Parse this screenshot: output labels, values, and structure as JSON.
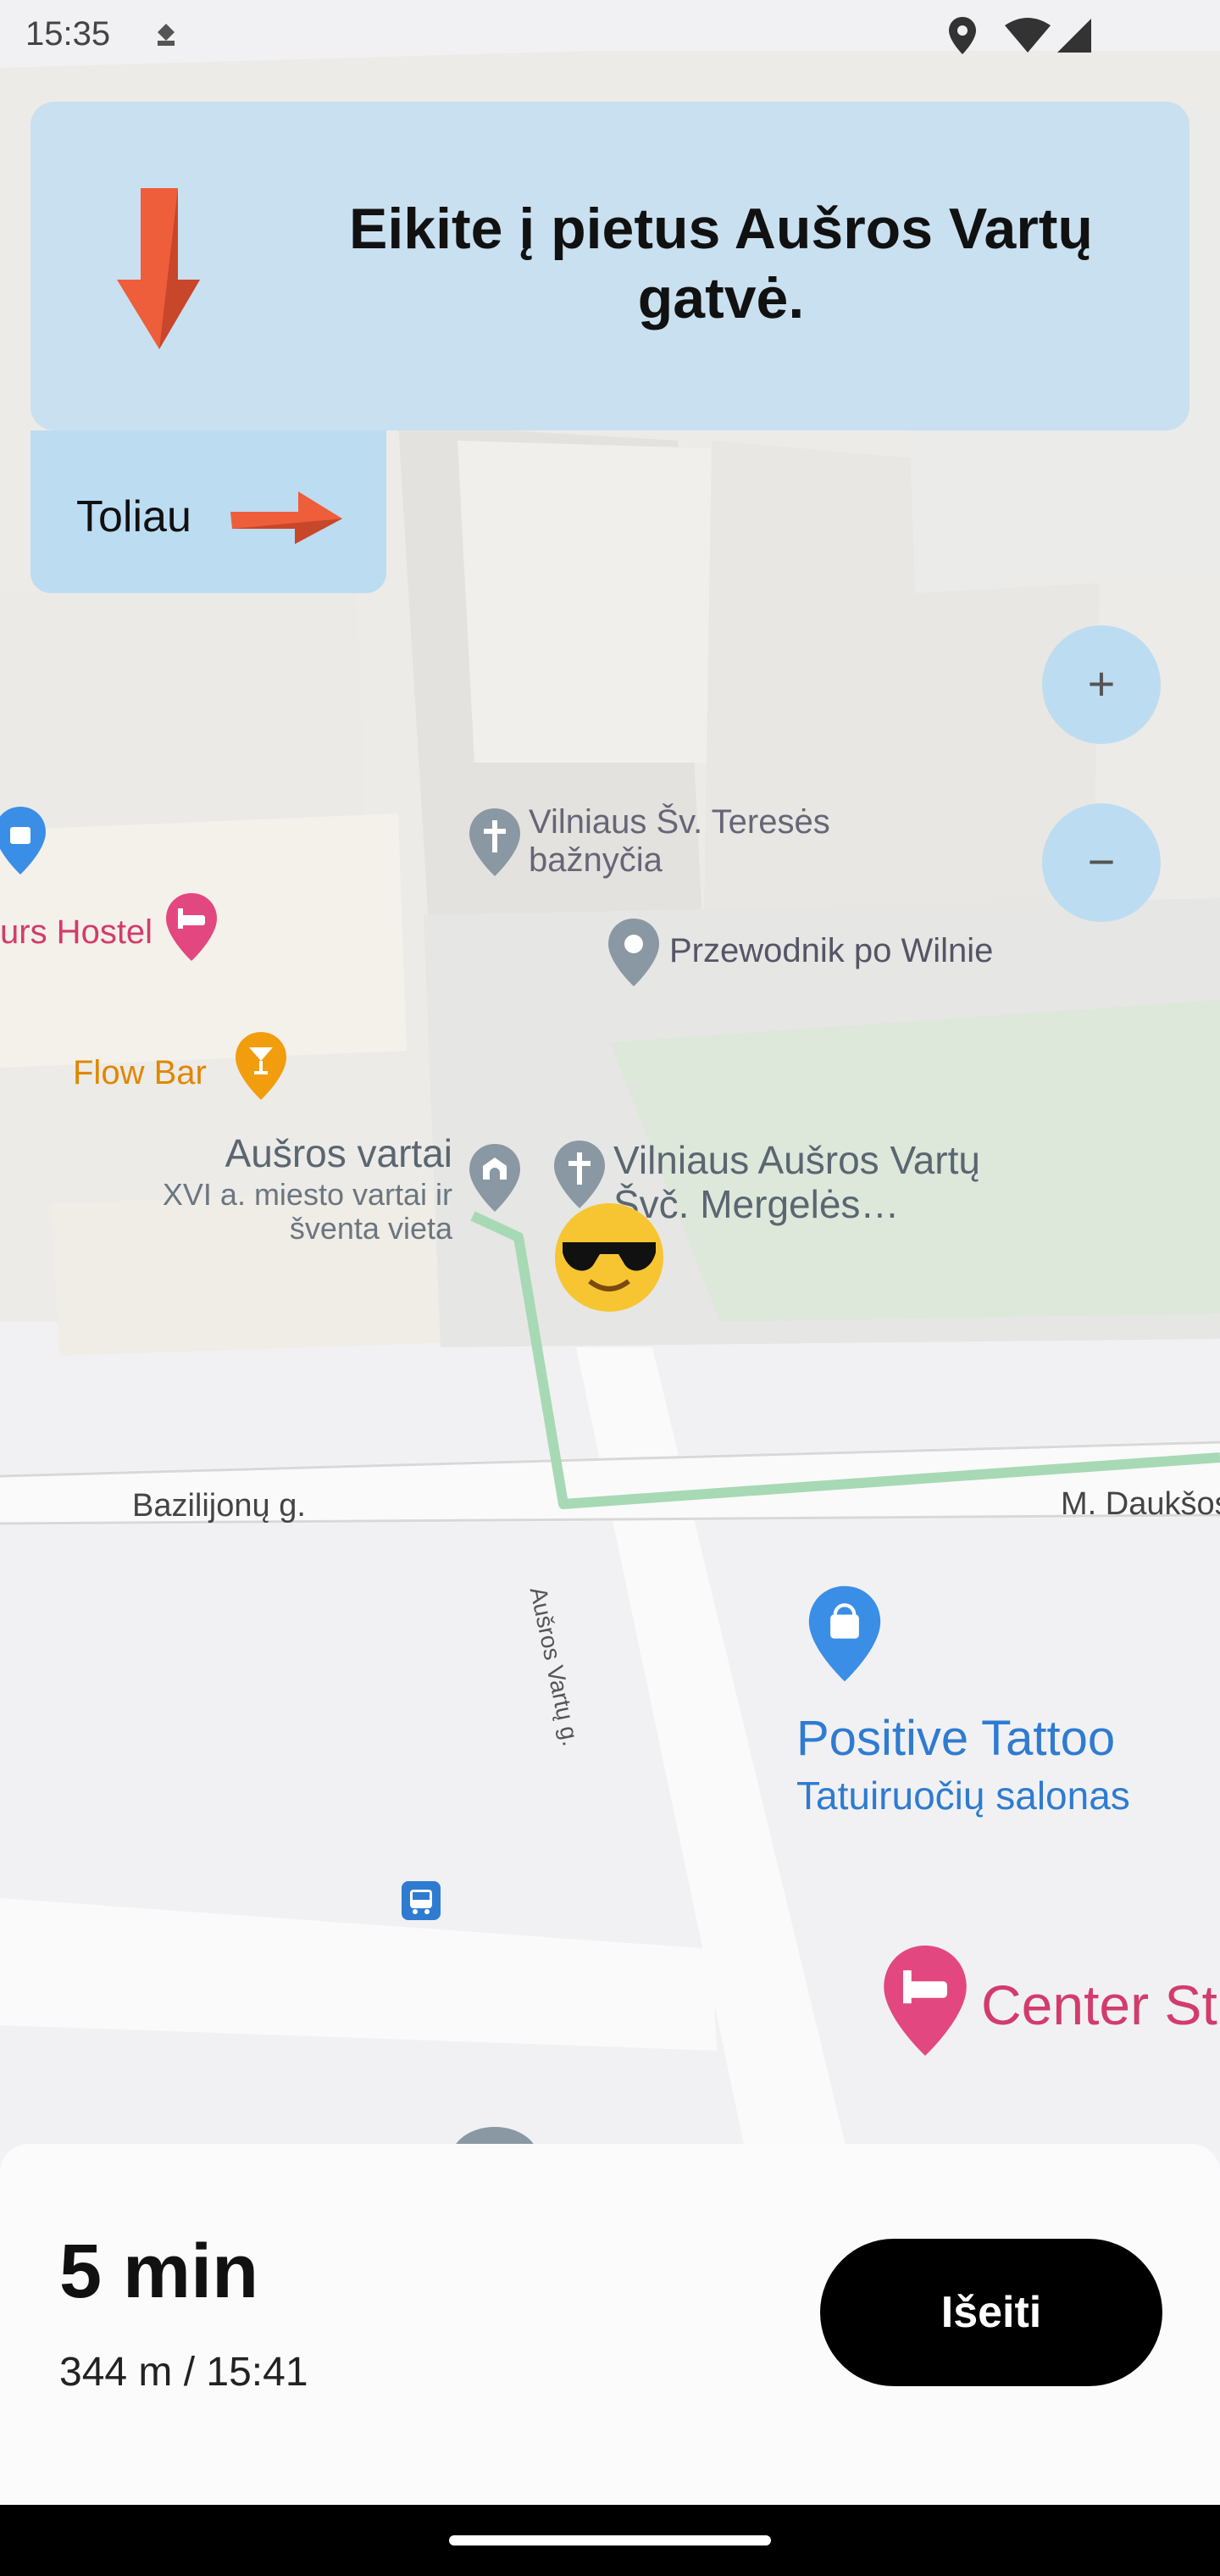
{
  "status_bar": {
    "time": "15:35"
  },
  "instruction": {
    "text": "Eikite į pietus Aušros Vartų gatvė.",
    "arrow_icon": "arrow-south-icon"
  },
  "next_step": {
    "label": "Toliau",
    "arrow_icon": "arrow-east-icon"
  },
  "zoom": {
    "in_label": "+",
    "out_label": "−"
  },
  "map": {
    "pois": {
      "church_teresa": "Vilniaus Šv. Teresės bažnyčia",
      "przewodnik": "Przewodnik po Wilnie",
      "hostel": "urs Hostel",
      "flow_bar": "Flow Bar",
      "ausros_vartai": "Aušros vartai",
      "ausros_vartai_sub": "XVI a. miesto vartai ir šventa vieta",
      "chapel": "Vilniaus Aušros Vartų Švč. Mergelės…",
      "tattoo": "Positive Tattoo",
      "tattoo_sub": "Tatuiruočių salonas",
      "center": "Center St"
    },
    "streets": {
      "bazilijonu": "Bazilijonų g.",
      "dauksos": "M. Daukšos",
      "ausros_vartu": "Aušros Vartų g."
    },
    "colors": {
      "route": "#a7d9b4",
      "hotel_pin": "#e2487f",
      "shop_pin": "#3b8ee6",
      "bar_pin": "#f29d0e",
      "church_pin": "#8a98a3"
    }
  },
  "trip": {
    "duration": "5 min",
    "distance_eta": "344 m / 15:41",
    "exit_label": "Išeiti"
  }
}
